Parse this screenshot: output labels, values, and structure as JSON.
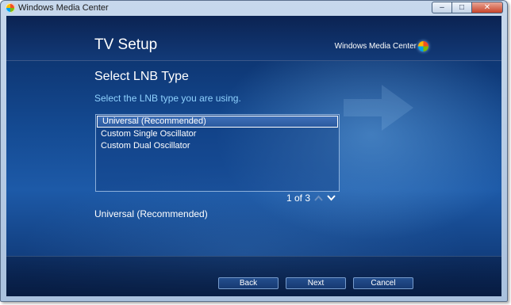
{
  "window": {
    "title": "Windows Media Center",
    "minimize_glyph": "–",
    "maximize_glyph": "□",
    "close_glyph": "✕"
  },
  "header": {
    "title": "TV Setup",
    "brand": "Windows Media Center"
  },
  "main": {
    "heading": "Select LNB Type",
    "instruction": "Select the LNB type you are using.",
    "options": [
      {
        "label": "Universal (Recommended)",
        "selected": true
      },
      {
        "label": "Custom Single Oscillator",
        "selected": false
      },
      {
        "label": "Custom Dual Oscillator",
        "selected": false
      }
    ],
    "pager": "1 of 3",
    "description": "Universal (Recommended)"
  },
  "footer": {
    "back_label": "Back",
    "next_label": "Next",
    "cancel_label": "Cancel"
  },
  "colors": {
    "accent_text": "#8fd2ff",
    "background_dark": "#0a2a60",
    "background_mid": "#1d5aa8"
  },
  "icons": {
    "app": "media-center-logo-icon",
    "pager_up": "chevron-up-icon",
    "pager_down": "chevron-down-icon",
    "decorative": "right-arrow-icon"
  }
}
